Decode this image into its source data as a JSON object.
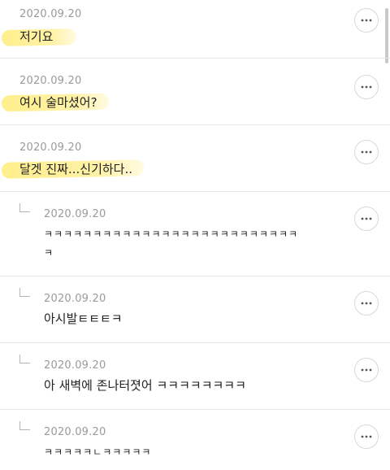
{
  "comments": [
    {
      "date": "2020.09.20",
      "text": "저기요",
      "reply": false
    },
    {
      "date": "2020.09.20",
      "text": "여시 술마셨어?",
      "reply": false
    },
    {
      "date": "2020.09.20",
      "text": "달겟 진짜...신기하다..",
      "reply": false
    },
    {
      "date": "2020.09.20",
      "text": "ㅋㅋㅋㅋㅋㅋㅋㅋㅋㅋㅋㅋㅋㅋㅋㅋㅋㅋㅋㅋㅋㅋㅋㅋㅋㅋ",
      "text_line2": "ㅋ",
      "reply": true
    },
    {
      "date": "2020.09.20",
      "text": "아시발ㅌㅌㅌㅋ",
      "reply": true
    },
    {
      "date": "2020.09.20",
      "text": "아 새벽에 존나터졋어 ㅋㅋㅋㅋㅋㅋㅋㅋ",
      "reply": true
    },
    {
      "date": "2020.09.20",
      "text": "ㅋㅋㅋㅋㅋㄴㅋㅋㅋㅋㅋ",
      "reply": true
    }
  ],
  "icons": {
    "more": "more-horizontal-icon",
    "reply": "reply-indent-icon"
  },
  "colors": {
    "highlight": "#ffe978",
    "date": "#9a9a9a",
    "text": "#222222",
    "divider": "#e6e6e6"
  }
}
